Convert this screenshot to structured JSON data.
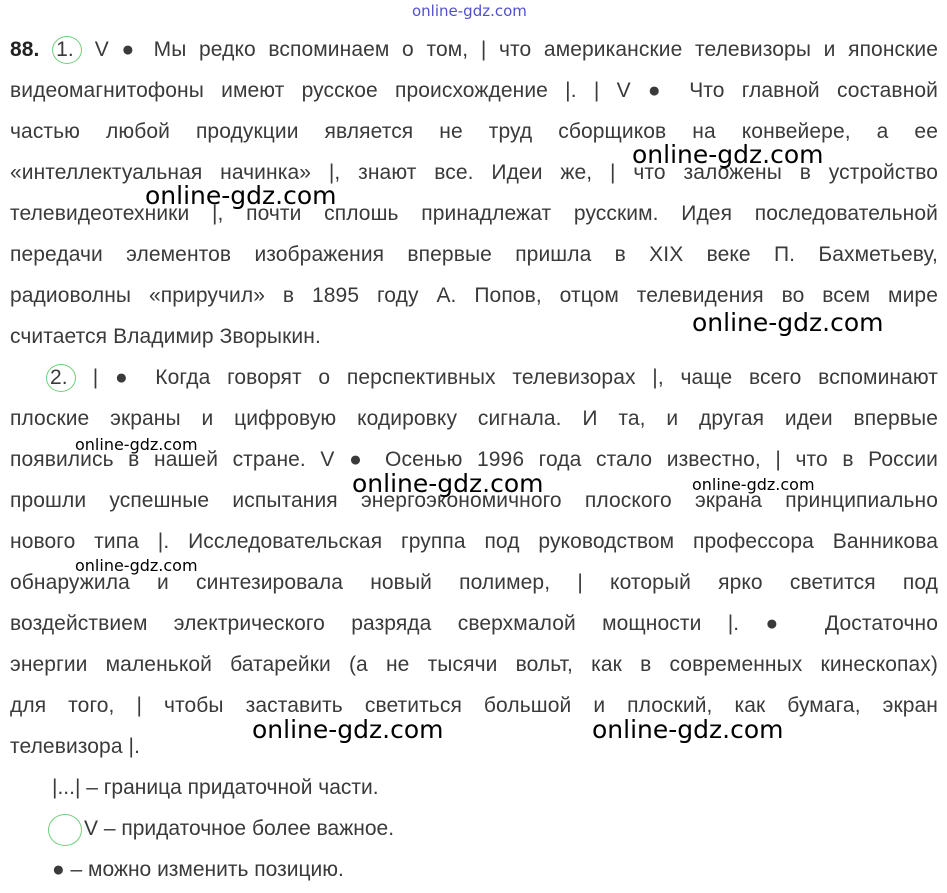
{
  "watermark_top": "online-gdz.com",
  "watermarks": [
    "online-gdz.com",
    "online-gdz.com",
    "online-gdz.com",
    "online-gdz.com",
    "online-gdz.com",
    "online-gdz.com",
    "online-gdz.com",
    "online-gdz.com",
    "online-gdz.com",
    "online-gdz.com"
  ],
  "exercise_number": "88.",
  "part1_marker": "1.",
  "part2_marker": "2.",
  "lines": [
    " V ● Мы редко вспоминаем о том, | что американские телевизоры и японские",
    "видеомагнитофоны имеют русское происхождение |. | V ● Что главной составной",
    "частью любой продукции является не труд сборщиков на конвейере, а ее",
    "«интеллектуальная начинка» |, знают все. Идеи же, | что заложены в устройство",
    "телевидеотехники |, почти сплошь принадлежат русским. Идея последовательной",
    "передачи элементов изображения впервые пришла в XIX веке П. Бахметьеву,",
    "радиоволны «приручил» в 1895 году А. Попов, отцом телевидения во всем мире",
    "считается Владимир Зворыкин.",
    " | ● Когда говорят о перспективных телевизорах |, чаще всего вспоминают",
    "плоские экраны и цифровую кодировку сигнала. И та, и другая идеи впервые",
    "появились в нашей стране. V ● Осенью 1996 года стало известно, | что в России",
    "прошли успешные испытания энергоэкономичного плоского экрана принципиально",
    "нового типа |. Исследовательская группа под руководством профессора Ванникова",
    "обнаружила и синтезировала новый полимер, | который ярко светится под",
    "воздействием электрического разряда сверхмалой мощности |. ● Достаточно",
    "энергии маленькой батарейки (а не тысячи вольт, как в современных кинескопах)",
    "для того, | чтобы заставить светиться большой и плоский, как бумага, экран",
    "телевизора |."
  ],
  "legend": {
    "boundary": "|...| – граница придаточной части.",
    "important": "V – придаточное более важное.",
    "movable": "● – можно изменить позицию."
  }
}
